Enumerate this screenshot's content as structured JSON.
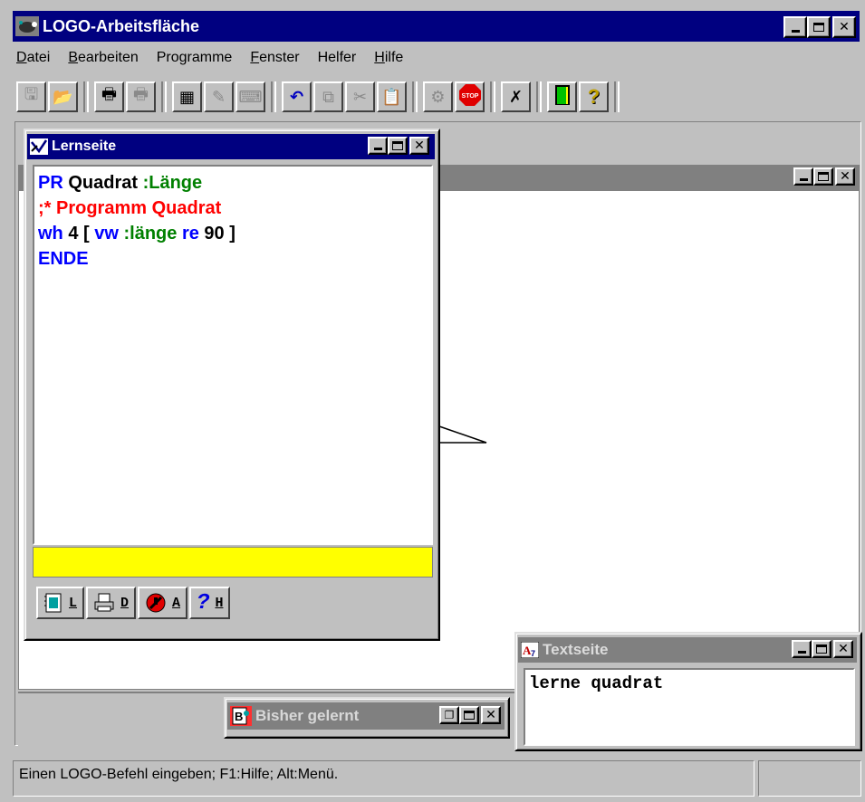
{
  "app": {
    "title": "LOGO-Arbeitsfläche",
    "icon": "turtle-icon"
  },
  "menu": [
    {
      "label": "Datei",
      "mnemonic": "D"
    },
    {
      "label": "Bearbeiten",
      "mnemonic": "B"
    },
    {
      "label": "Programme",
      "mnemonic": ""
    },
    {
      "label": "Fenster",
      "mnemonic": "F"
    },
    {
      "label": "Helfer",
      "mnemonic": ""
    },
    {
      "label": "Hilfe",
      "mnemonic": "H"
    }
  ],
  "toolbar": [
    {
      "icon": "save-icon",
      "enabled": false
    },
    {
      "icon": "open-folder-icon",
      "enabled": true
    },
    {
      "icon": "print-icon",
      "enabled": true
    },
    {
      "icon": "print-preview-icon",
      "enabled": false
    },
    {
      "icon": "new-window-icon",
      "enabled": true
    },
    {
      "icon": "edit-page-icon",
      "enabled": false
    },
    {
      "icon": "keyboard-icon",
      "enabled": false
    },
    {
      "icon": "undo-icon",
      "enabled": true
    },
    {
      "icon": "copy-icon",
      "enabled": false
    },
    {
      "icon": "cut-icon",
      "enabled": false
    },
    {
      "icon": "paste-icon",
      "enabled": false
    },
    {
      "icon": "turtle-tool-icon",
      "enabled": false
    },
    {
      "icon": "stop-icon",
      "enabled": true
    },
    {
      "icon": "clear-page-icon",
      "enabled": true
    },
    {
      "icon": "exit-door-icon",
      "enabled": true
    },
    {
      "icon": "help-question-icon",
      "enabled": true
    }
  ],
  "lernseite": {
    "title": "Lernseite",
    "code_lines": [
      [
        {
          "t": "PR ",
          "c": "blue"
        },
        {
          "t": "Quadrat ",
          "c": "black"
        },
        {
          "t": ":Länge",
          "c": "green"
        }
      ],
      [
        {
          "t": ";* Programm Quadrat",
          "c": "red"
        }
      ],
      [
        {
          "t": "wh ",
          "c": "blue"
        },
        {
          "t": "4 [ ",
          "c": "black"
        },
        {
          "t": "vw ",
          "c": "blue"
        },
        {
          "t": ":länge ",
          "c": "green"
        },
        {
          "t": "re ",
          "c": "blue"
        },
        {
          "t": "90 ]",
          "c": "black"
        }
      ],
      [
        {
          "t": "ENDE",
          "c": "blue"
        }
      ]
    ],
    "status_color": "#ffff00",
    "buttons": [
      {
        "icon": "learn-notebook-icon",
        "key": "L"
      },
      {
        "icon": "printer-icon",
        "key": "D"
      },
      {
        "icon": "abort-icon",
        "key": "A"
      },
      {
        "icon": "help-icon",
        "key": "H"
      }
    ]
  },
  "textseite": {
    "title": "Textseite",
    "content": "lerne quadrat"
  },
  "bisher": {
    "title": "Bisher gelernt"
  },
  "statusbar": {
    "text": "Einen LOGO-Befehl eingeben; F1:Hilfe; Alt:Menü."
  },
  "colors": {
    "active_title": "#000080",
    "inactive_title": "#808080",
    "face": "#c0c0c0"
  }
}
